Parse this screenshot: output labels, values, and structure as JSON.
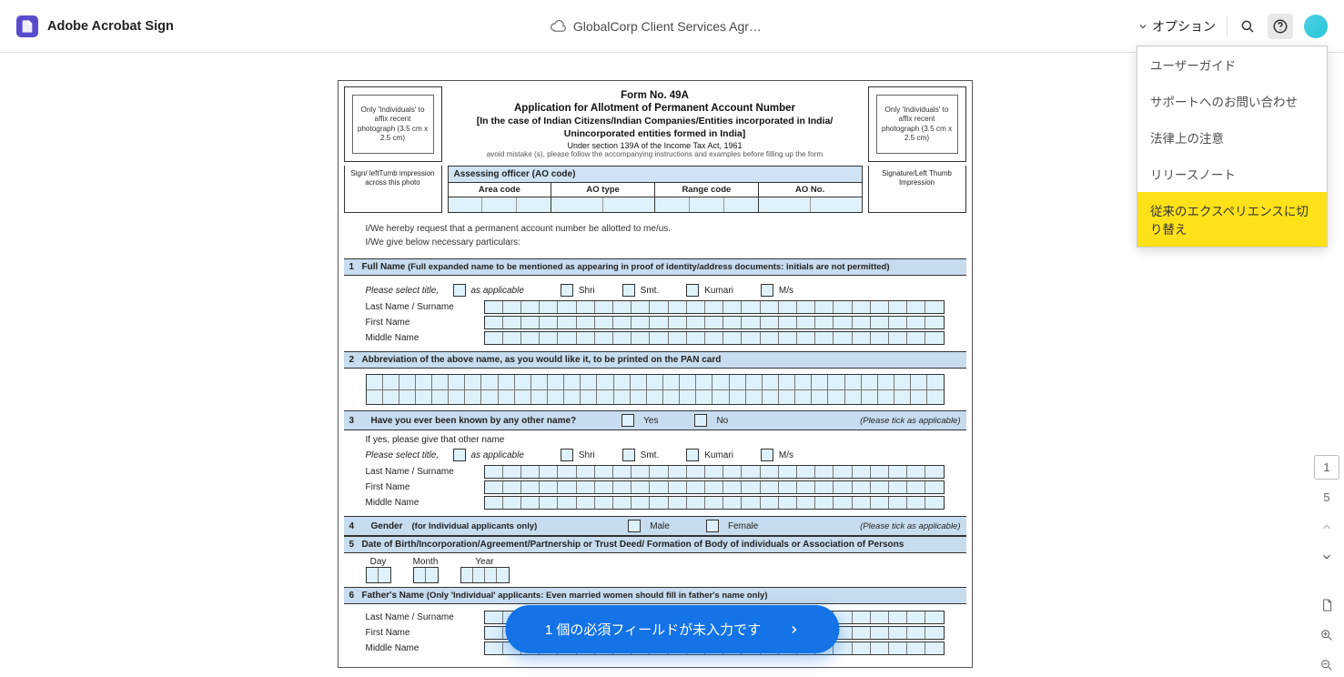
{
  "header": {
    "app_name": "Adobe Acrobat Sign",
    "doc_title": "GlobalCorp Client Services Agr…",
    "options_label": "オプション"
  },
  "help_menu": {
    "items": [
      "ユーザーガイド",
      "サポートへのお問い合わせ",
      "法律上の注意",
      "リリースノート",
      "従来のエクスペリエンスに切り替え"
    ]
  },
  "form": {
    "form_no": "Form No. 49A",
    "title": "Application for Allotment of Permanent Account Number",
    "subtitle1": "[In the  case of Indian Citizens/Indian Companies/Entities incorporated in India/",
    "subtitle2": "Unincorporated entities formed in India]",
    "under": "Under section 139A of the Income Tax Act, 1961",
    "avoid": "avoid mistake (s), please follow the accompanying instructions and examples before filling up the form",
    "photo_note": "Only 'Individuals' to affix recent photograph (3.5 cm x 2.5 cm)",
    "sign_left": "Sign/ leftTumb impression across this photo",
    "sign_right": "Signature/Left Thumb Impression",
    "ao": {
      "header": "Assessing officer  (AO code)",
      "cols": [
        "Area code",
        "AO type",
        "Range code",
        "AO No."
      ]
    },
    "request1": "I/We hereby request that a permanent account number be allotted to me/us.",
    "request2": "I/We give below necessary particulars:",
    "sections": {
      "s1": {
        "num": "1",
        "title": "Full Name",
        "note": "(Full expanded name to be mentioned as appearing in proof of identity/address documents: initials are not permitted)"
      },
      "s2": {
        "num": "2",
        "title": "Abbreviation of the above name, as you would like it, to be printed on the PAN card"
      },
      "s3": {
        "num": "3",
        "title": "Have you ever been known by any other name?",
        "yes": "Yes",
        "no": "No",
        "tick": "(Please tick as applicable)",
        "if_yes": "If yes, please give that other name"
      },
      "s4": {
        "num": "4",
        "title": "Gender",
        "note": "(for Individual applicants only)",
        "male": "Male",
        "female": "Female",
        "tick": "(Please tick as applicable)"
      },
      "s5": {
        "num": "5",
        "title": "Date of Birth/Incorporation/Agreement/Partnership or Trust Deed/ Formation of Body of individuals or Association of Persons",
        "day": "Day",
        "month": "Month",
        "year": "Year"
      },
      "s6": {
        "num": "6",
        "title": "Father's Name",
        "note": "(Only 'Individual' applicants: Even married women should fill in father's name only)"
      }
    },
    "sel": {
      "please": "Please select title,",
      "as_app": "as applicable",
      "shri": "Shri",
      "smt": "Smt.",
      "kumari": "Kumari",
      "ms": "M/s"
    },
    "names": {
      "last": "Last Name / Surname",
      "first": "First Name",
      "middle": "Middle Name"
    }
  },
  "cta": {
    "text": "1 個の必須フィールドが未入力です"
  },
  "rail": {
    "page_current": "1",
    "page_total": "5"
  }
}
